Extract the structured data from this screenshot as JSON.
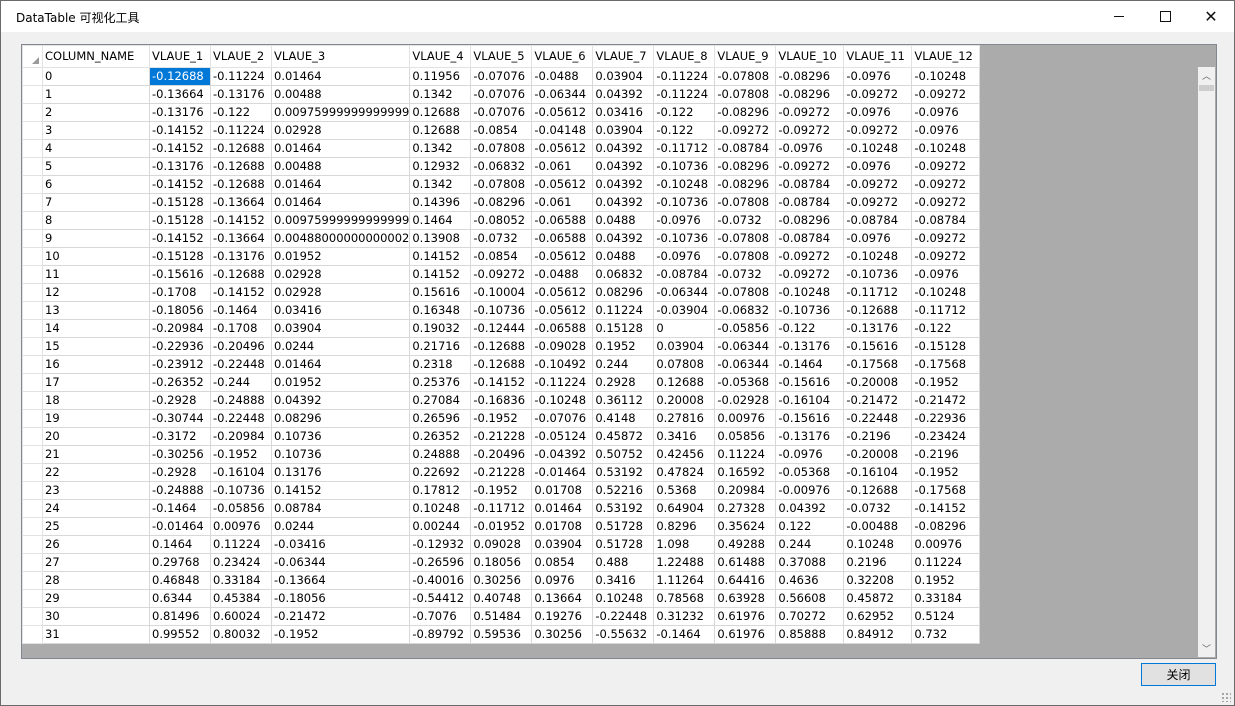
{
  "window": {
    "title": "DataTable 可视化工具"
  },
  "buttons": {
    "close_label": "关闭"
  },
  "table": {
    "columns": [
      "COLUMN_NAME",
      "VLAUE_1",
      "VLAUE_2",
      "VLAUE_3",
      "VLAUE_4",
      "VLAUE_5",
      "VLAUE_6",
      "VLAUE_7",
      "VLAUE_8",
      "VLAUE_9",
      "VLAUE_10",
      "VLAUE_11",
      "VLAUE_12"
    ],
    "rows": [
      [
        "0",
        "-0.12688",
        "-0.11224",
        "0.01464",
        "0.11956",
        "-0.07076",
        "-0.0488",
        "0.03904",
        "-0.11224",
        "-0.07808",
        "-0.08296",
        "-0.0976",
        "-0.10248"
      ],
      [
        "1",
        "-0.13664",
        "-0.13176",
        "0.00488",
        "0.1342",
        "-0.07076",
        "-0.06344",
        "0.04392",
        "-0.11224",
        "-0.07808",
        "-0.08296",
        "-0.09272",
        "-0.09272"
      ],
      [
        "2",
        "-0.13176",
        "-0.122",
        "0.00975999999999999",
        "0.12688",
        "-0.07076",
        "-0.05612",
        "0.03416",
        "-0.122",
        "-0.08296",
        "-0.09272",
        "-0.0976",
        "-0.0976"
      ],
      [
        "3",
        "-0.14152",
        "-0.11224",
        "0.02928",
        "0.12688",
        "-0.0854",
        "-0.04148",
        "0.03904",
        "-0.122",
        "-0.09272",
        "-0.09272",
        "-0.09272",
        "-0.0976"
      ],
      [
        "4",
        "-0.14152",
        "-0.12688",
        "0.01464",
        "0.1342",
        "-0.07808",
        "-0.05612",
        "0.04392",
        "-0.11712",
        "-0.08784",
        "-0.0976",
        "-0.10248",
        "-0.10248"
      ],
      [
        "5",
        "-0.13176",
        "-0.12688",
        "0.00488",
        "0.12932",
        "-0.06832",
        "-0.061",
        "0.04392",
        "-0.10736",
        "-0.08296",
        "-0.09272",
        "-0.0976",
        "-0.09272"
      ],
      [
        "6",
        "-0.14152",
        "-0.12688",
        "0.01464",
        "0.1342",
        "-0.07808",
        "-0.05612",
        "0.04392",
        "-0.10248",
        "-0.08296",
        "-0.08784",
        "-0.09272",
        "-0.09272"
      ],
      [
        "7",
        "-0.15128",
        "-0.13664",
        "0.01464",
        "0.14396",
        "-0.08296",
        "-0.061",
        "0.04392",
        "-0.10736",
        "-0.07808",
        "-0.08784",
        "-0.09272",
        "-0.09272"
      ],
      [
        "8",
        "-0.15128",
        "-0.14152",
        "0.00975999999999999",
        "0.1464",
        "-0.08052",
        "-0.06588",
        "0.0488",
        "-0.0976",
        "-0.0732",
        "-0.08296",
        "-0.08784",
        "-0.08784"
      ],
      [
        "9",
        "-0.14152",
        "-0.13664",
        "0.00488000000000002",
        "0.13908",
        "-0.0732",
        "-0.06588",
        "0.04392",
        "-0.10736",
        "-0.07808",
        "-0.08784",
        "-0.0976",
        "-0.09272"
      ],
      [
        "10",
        "-0.15128",
        "-0.13176",
        "0.01952",
        "0.14152",
        "-0.0854",
        "-0.05612",
        "0.0488",
        "-0.0976",
        "-0.07808",
        "-0.09272",
        "-0.10248",
        "-0.09272"
      ],
      [
        "11",
        "-0.15616",
        "-0.12688",
        "0.02928",
        "0.14152",
        "-0.09272",
        "-0.0488",
        "0.06832",
        "-0.08784",
        "-0.0732",
        "-0.09272",
        "-0.10736",
        "-0.0976"
      ],
      [
        "12",
        "-0.1708",
        "-0.14152",
        "0.02928",
        "0.15616",
        "-0.10004",
        "-0.05612",
        "0.08296",
        "-0.06344",
        "-0.07808",
        "-0.10248",
        "-0.11712",
        "-0.10248"
      ],
      [
        "13",
        "-0.18056",
        "-0.1464",
        "0.03416",
        "0.16348",
        "-0.10736",
        "-0.05612",
        "0.11224",
        "-0.03904",
        "-0.06832",
        "-0.10736",
        "-0.12688",
        "-0.11712"
      ],
      [
        "14",
        "-0.20984",
        "-0.1708",
        "0.03904",
        "0.19032",
        "-0.12444",
        "-0.06588",
        "0.15128",
        "0",
        "-0.05856",
        "-0.122",
        "-0.13176",
        "-0.122"
      ],
      [
        "15",
        "-0.22936",
        "-0.20496",
        "0.0244",
        "0.21716",
        "-0.12688",
        "-0.09028",
        "0.1952",
        "0.03904",
        "-0.06344",
        "-0.13176",
        "-0.15616",
        "-0.15128"
      ],
      [
        "16",
        "-0.23912",
        "-0.22448",
        "0.01464",
        "0.2318",
        "-0.12688",
        "-0.10492",
        "0.244",
        "0.07808",
        "-0.06344",
        "-0.1464",
        "-0.17568",
        "-0.17568"
      ],
      [
        "17",
        "-0.26352",
        "-0.244",
        "0.01952",
        "0.25376",
        "-0.14152",
        "-0.11224",
        "0.2928",
        "0.12688",
        "-0.05368",
        "-0.15616",
        "-0.20008",
        "-0.1952"
      ],
      [
        "18",
        "-0.2928",
        "-0.24888",
        "0.04392",
        "0.27084",
        "-0.16836",
        "-0.10248",
        "0.36112",
        "0.20008",
        "-0.02928",
        "-0.16104",
        "-0.21472",
        "-0.21472"
      ],
      [
        "19",
        "-0.30744",
        "-0.22448",
        "0.08296",
        "0.26596",
        "-0.1952",
        "-0.07076",
        "0.4148",
        "0.27816",
        "0.00976",
        "-0.15616",
        "-0.22448",
        "-0.22936"
      ],
      [
        "20",
        "-0.3172",
        "-0.20984",
        "0.10736",
        "0.26352",
        "-0.21228",
        "-0.05124",
        "0.45872",
        "0.3416",
        "0.05856",
        "-0.13176",
        "-0.2196",
        "-0.23424"
      ],
      [
        "21",
        "-0.30256",
        "-0.1952",
        "0.10736",
        "0.24888",
        "-0.20496",
        "-0.04392",
        "0.50752",
        "0.42456",
        "0.11224",
        "-0.0976",
        "-0.20008",
        "-0.2196"
      ],
      [
        "22",
        "-0.2928",
        "-0.16104",
        "0.13176",
        "0.22692",
        "-0.21228",
        "-0.01464",
        "0.53192",
        "0.47824",
        "0.16592",
        "-0.05368",
        "-0.16104",
        "-0.1952"
      ],
      [
        "23",
        "-0.24888",
        "-0.10736",
        "0.14152",
        "0.17812",
        "-0.1952",
        "0.01708",
        "0.52216",
        "0.5368",
        "0.20984",
        "-0.00976",
        "-0.12688",
        "-0.17568"
      ],
      [
        "24",
        "-0.1464",
        "-0.05856",
        "0.08784",
        "0.10248",
        "-0.11712",
        "0.01464",
        "0.53192",
        "0.64904",
        "0.27328",
        "0.04392",
        "-0.0732",
        "-0.14152"
      ],
      [
        "25",
        "-0.01464",
        "0.00976",
        "0.0244",
        "0.00244",
        "-0.01952",
        "0.01708",
        "0.51728",
        "0.8296",
        "0.35624",
        "0.122",
        "-0.00488",
        "-0.08296"
      ],
      [
        "26",
        "0.1464",
        "0.11224",
        "-0.03416",
        "-0.12932",
        "0.09028",
        "0.03904",
        "0.51728",
        "1.098",
        "0.49288",
        "0.244",
        "0.10248",
        "0.00976"
      ],
      [
        "27",
        "0.29768",
        "0.23424",
        "-0.06344",
        "-0.26596",
        "0.18056",
        "0.0854",
        "0.488",
        "1.22488",
        "0.61488",
        "0.37088",
        "0.2196",
        "0.11224"
      ],
      [
        "28",
        "0.46848",
        "0.33184",
        "-0.13664",
        "-0.40016",
        "0.30256",
        "0.0976",
        "0.3416",
        "1.11264",
        "0.64416",
        "0.4636",
        "0.32208",
        "0.1952"
      ],
      [
        "29",
        "0.6344",
        "0.45384",
        "-0.18056",
        "-0.54412",
        "0.40748",
        "0.13664",
        "0.10248",
        "0.78568",
        "0.63928",
        "0.56608",
        "0.45872",
        "0.33184"
      ],
      [
        "30",
        "0.81496",
        "0.60024",
        "-0.21472",
        "-0.7076",
        "0.51484",
        "0.19276",
        "-0.22448",
        "0.31232",
        "0.61976",
        "0.70272",
        "0.62952",
        "0.5124"
      ],
      [
        "31",
        "0.99552",
        "0.80032",
        "-0.1952",
        "-0.89792",
        "0.59536",
        "0.30256",
        "-0.55632",
        "-0.1464",
        "0.61976",
        "0.85888",
        "0.84912",
        "0.732"
      ]
    ]
  }
}
